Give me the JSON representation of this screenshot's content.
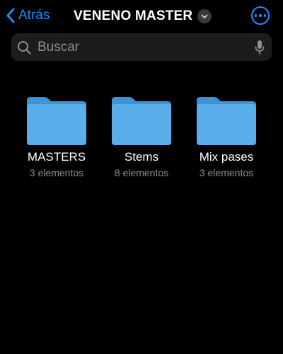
{
  "nav": {
    "back_label": "Atrás",
    "title": "VENENO MASTER",
    "back_icon": "chevron-left-icon",
    "title_menu_icon": "chevron-down-icon",
    "more_icon": "ellipsis-circle-icon"
  },
  "search": {
    "placeholder": "Buscar",
    "value": "",
    "search_icon": "magnifying-glass-icon",
    "mic_icon": "microphone-icon"
  },
  "folders": [
    {
      "name": "MASTERS",
      "count": "3 elementos",
      "icon": "folder-icon"
    },
    {
      "name": "Stems",
      "count": "8 elementos",
      "icon": "folder-icon"
    },
    {
      "name": "Mix pases",
      "count": "3 elementos",
      "icon": "folder-icon"
    }
  ],
  "colors": {
    "background": "#000000",
    "accent": "#1a8cff",
    "search_bg": "#1c1c1e",
    "secondary_text": "#8e8e93",
    "folder_body": "#5aaeea",
    "folder_tab": "#3d93d6"
  }
}
